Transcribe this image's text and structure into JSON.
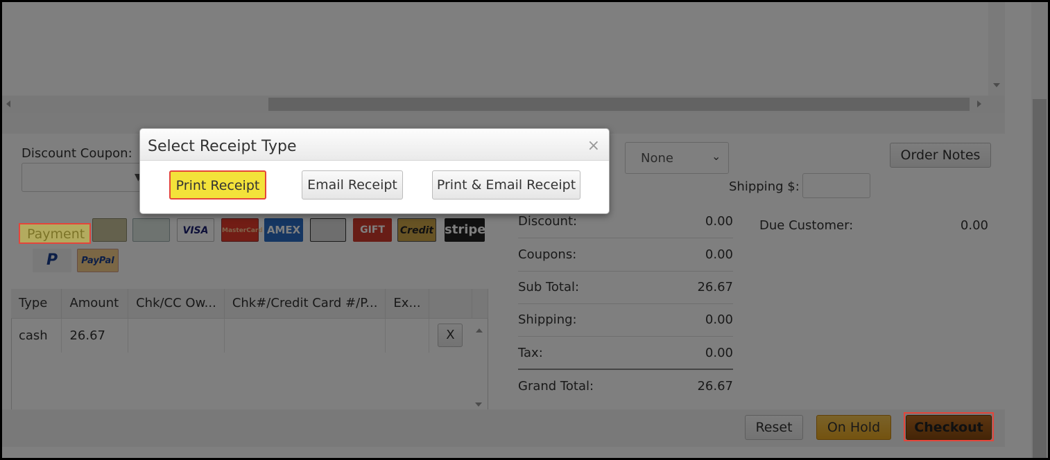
{
  "coupon": {
    "label": "Discount Coupon:"
  },
  "shipping_method": {
    "selected": "None"
  },
  "order_notes_button": "Order Notes",
  "shipping": {
    "label": "Shipping $:",
    "value": ""
  },
  "payment": {
    "label": "Payment",
    "methods": [
      "cash-icon",
      "check-icon",
      "VISA",
      "MasterCard",
      "AMEX",
      "credit-card-icon",
      "GIFT",
      "Credit",
      "stripe",
      "paypal-p-icon",
      "PayPal"
    ]
  },
  "payments_table": {
    "columns": [
      "Type",
      "Amount",
      "Chk/CC Ow...",
      "Chk#/Credit Card #/P...",
      "Ex..."
    ],
    "rows": [
      {
        "type": "cash",
        "amount": "26.67",
        "owner": "",
        "number": "",
        "exp": "",
        "remove": "X"
      }
    ]
  },
  "totals": [
    {
      "label": "Discount:",
      "value": "0.00"
    },
    {
      "label": "Coupons:",
      "value": "0.00"
    },
    {
      "label": "Sub Total:",
      "value": "26.67"
    },
    {
      "label": "Shipping:",
      "value": "0.00"
    },
    {
      "label": "Tax:",
      "value": "0.00"
    },
    {
      "label": "Grand Total:",
      "value": "26.67"
    }
  ],
  "due_customer": {
    "label": "Due Customer:",
    "value": "0.00"
  },
  "actions": {
    "reset": "Reset",
    "on_hold": "On Hold",
    "checkout": "Checkout"
  },
  "modal": {
    "title": "Select Receipt Type",
    "close": "×",
    "buttons": {
      "print": "Print Receipt",
      "email": "Email Receipt",
      "print_email": "Print & Email Receipt"
    }
  },
  "colors": {
    "highlight_border": "#e4453a",
    "highlight_fill": "#f3e23a",
    "checkout": "#8a4a0e",
    "on_hold": "#e8a620"
  }
}
